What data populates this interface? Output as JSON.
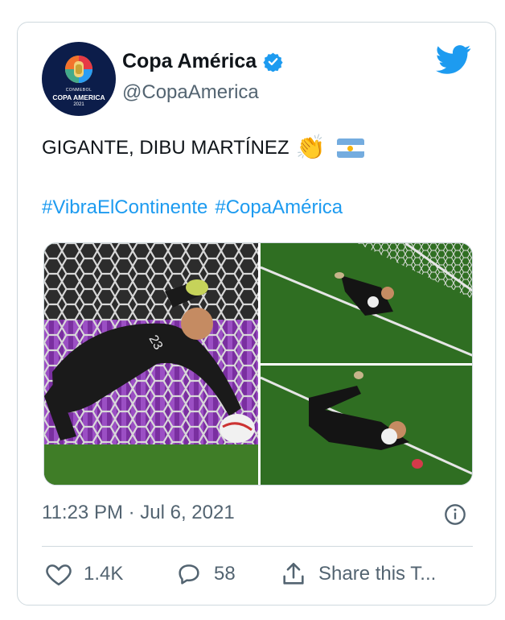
{
  "author": {
    "name": "Copa América",
    "handle": "@CopaAmerica",
    "verified": true,
    "avatar": {
      "org": "CONMEBOL",
      "brand": "COPA AMERICA",
      "year": "2021"
    }
  },
  "tweet": {
    "text": "GIGANTE, DIBU MARTÍNEZ",
    "emoji": "👏",
    "flag": "argentina-flag",
    "hashtags": [
      "#VibraElContinente",
      "#CopaAmérica"
    ],
    "timestamp": "11:23 PM · Jul 6, 2021"
  },
  "media": {
    "photos": [
      {
        "name": "goalkeeper-dive-closeup",
        "jersey_number": "23"
      },
      {
        "name": "goalkeeper-dive-wide"
      },
      {
        "name": "goalkeeper-save-ground"
      }
    ]
  },
  "actions": {
    "like_count": "1.4K",
    "reply_count": "58",
    "share_label": "Share this T..."
  },
  "colors": {
    "link": "#1d9bf0",
    "verified": "#1d9bf0",
    "secondary_text": "#536471",
    "border": "#cfd9de"
  }
}
